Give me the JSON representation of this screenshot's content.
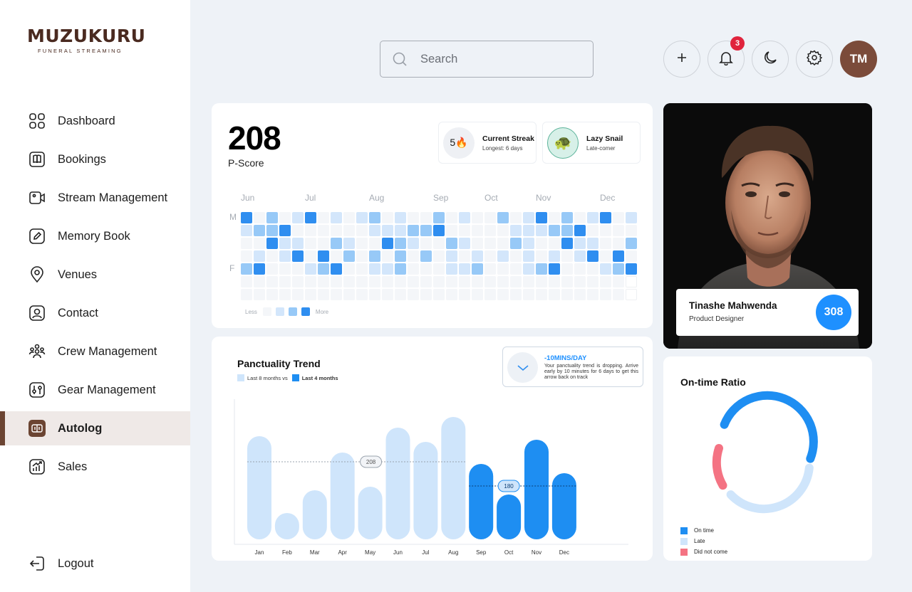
{
  "brand": {
    "name": "MUZUKURU",
    "tagline": "FUNERAL STREAMING"
  },
  "sidebar": {
    "items": [
      {
        "label": "Dashboard",
        "icon": "dashboard-grid-icon"
      },
      {
        "label": "Bookings",
        "icon": "book-icon"
      },
      {
        "label": "Stream Management",
        "icon": "video-camera-icon"
      },
      {
        "label": "Memory Book",
        "icon": "pencil-icon"
      },
      {
        "label": "Venues",
        "icon": "map-pin-icon"
      },
      {
        "label": "Contact",
        "icon": "contact-icon"
      },
      {
        "label": "Crew Management",
        "icon": "crew-icon"
      },
      {
        "label": "Gear Management",
        "icon": "gear-sliders-icon"
      },
      {
        "label": "Autolog",
        "icon": "autolog-icon",
        "active": true
      },
      {
        "label": "Sales",
        "icon": "sales-chart-icon"
      }
    ],
    "logout": "Logout"
  },
  "topbar": {
    "search_placeholder": "Search",
    "notification_count": "3",
    "avatar_initials": "TM"
  },
  "pscore": {
    "value": "208",
    "label": "P-Score",
    "streak": {
      "value": "5🔥",
      "title": "Current Streak",
      "sub": "Longest: 6 days"
    },
    "badge": {
      "icon": "🐢",
      "title": "Lazy Snail",
      "sub": "Late-comer"
    },
    "months": [
      "Jun",
      "Jul",
      "Aug",
      "Sep",
      "Oct",
      "Nov",
      "Dec"
    ],
    "day_labels": [
      "M",
      "F"
    ],
    "legend": {
      "less": "Less",
      "more": "More"
    },
    "levels": [
      "#f4f6f9",
      "#d3e6fb",
      "#97c9f7",
      "#2f8ef0"
    ]
  },
  "trend": {
    "title": "Panctuality Trend",
    "legend_prev": "Last 8 months vs",
    "legend_curr": "Last 4 months",
    "tip_title": "-10MINS/DAY",
    "tip_text": "Your panctuality trend is dropping. Arrive early by 10 minutes for 6 days to get this arrow back on track",
    "avg_prev": "208",
    "avg_curr": "180"
  },
  "chart_data": {
    "type": "bar",
    "title": "Panctuality Trend",
    "categories": [
      "Jan",
      "Feb",
      "Mar",
      "Apr",
      "May",
      "Jun",
      "Jul",
      "Aug",
      "Sep",
      "Oct",
      "Nov",
      "Dec"
    ],
    "series": [
      {
        "name": "Last 8 months vs",
        "values": [
          290,
          74,
          138,
          244,
          148,
          314,
          274,
          344,
          null,
          null,
          null,
          null
        ],
        "color": "#cfe5fb"
      },
      {
        "name": "Last 4 months",
        "values": [
          null,
          null,
          null,
          null,
          null,
          null,
          null,
          null,
          212,
          126,
          280,
          186
        ],
        "color": "#1e8ef2"
      }
    ],
    "reference_lines": [
      {
        "label": "208",
        "value": 218
      },
      {
        "label": "180",
        "value": 150
      }
    ],
    "ylim": [
      0,
      400
    ]
  },
  "profile": {
    "name": "Tinashe Mahwenda",
    "role": "Product Designer",
    "score": "308"
  },
  "ratio": {
    "title": "On-time Ratio",
    "legend": [
      {
        "label": "On time",
        "color": "#1e8ef2"
      },
      {
        "label": "Late",
        "color": "#cfe5fb"
      },
      {
        "label": "Did not come",
        "color": "#f47383"
      }
    ]
  }
}
